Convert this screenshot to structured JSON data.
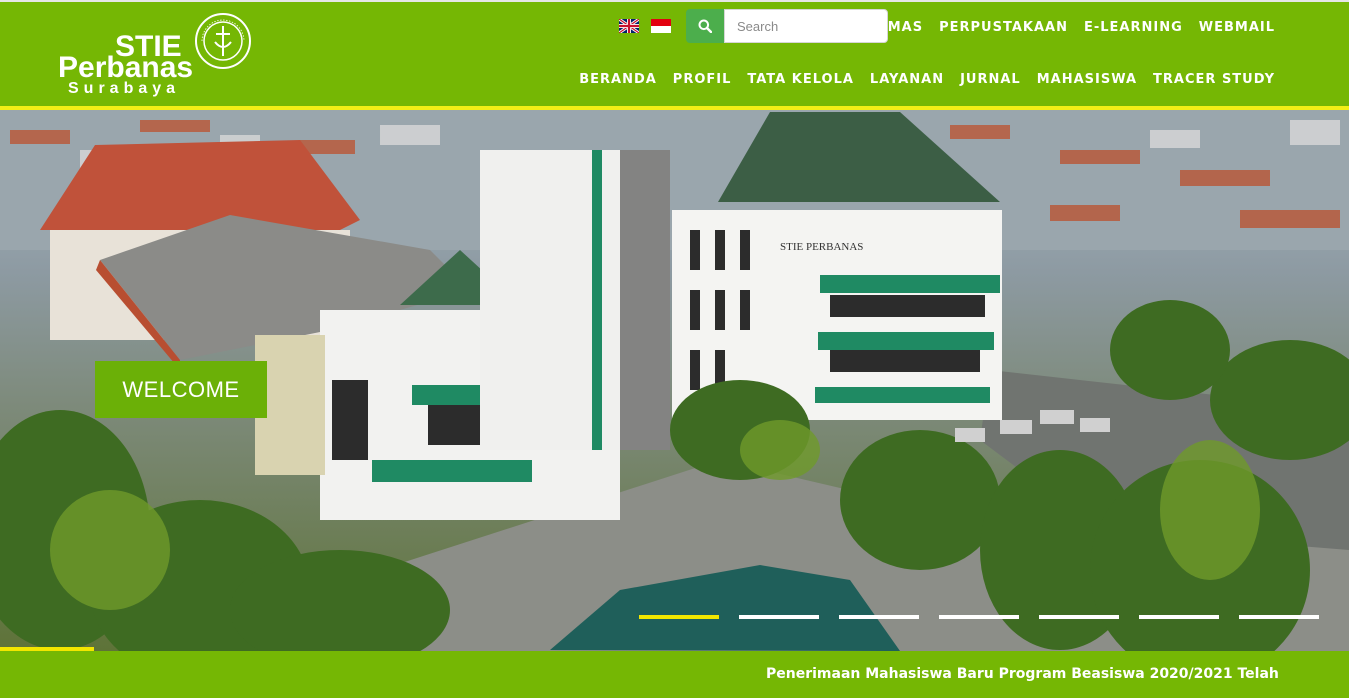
{
  "brand": {
    "line1": "STIE",
    "line2": "Perbanas",
    "line3": "Surabaya",
    "seal_text": "SEKOLAH TINGGI ILMU EKONOMI PERBANAS SURABAYA",
    "primary_color": "#75b704",
    "accent_color": "#f2ee16"
  },
  "languages": [
    {
      "icon": "uk-flag-icon"
    },
    {
      "icon": "indonesia-flag-icon"
    }
  ],
  "search": {
    "placeholder": "Search",
    "value": "",
    "icon": "search-icon"
  },
  "top_links": [
    "SIMAS",
    "PERPUSTAKAAN",
    "E-LEARNING",
    "WEBMAIL"
  ],
  "main_nav": [
    "BERANDA",
    "PROFIL",
    "TATA KELOLA",
    "LAYANAN",
    "JURNAL",
    "MAHASISWA",
    "TRACER STUDY"
  ],
  "hero": {
    "welcome": "WELCOME",
    "banner_text": "STIE PERBANAS",
    "slide_count": 7,
    "active_slide": 1,
    "slide_progress": 0.07
  },
  "ticker": {
    "text": "Penerimaan Mahasiswa Baru Program Beasiswa 2020/2021 Telah"
  }
}
